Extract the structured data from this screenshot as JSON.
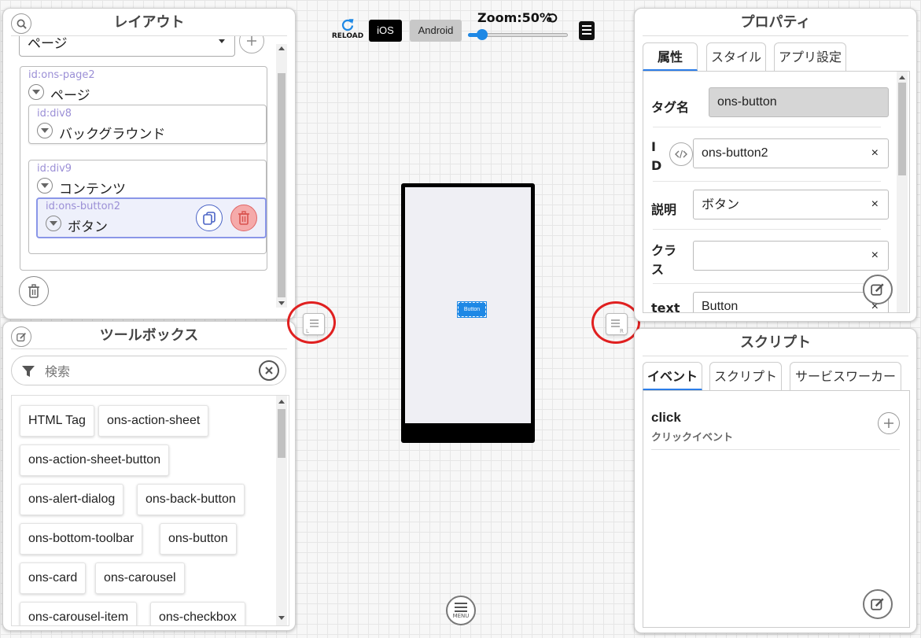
{
  "toolbar": {
    "reload_label": "RELOAD",
    "ios_label": "iOS",
    "android_label": "Android",
    "zoom_label": "Zoom:50%",
    "zoom_value": 0.1
  },
  "layout_panel": {
    "title": "レイアウト",
    "select_value": "ページ",
    "tree": {
      "page": {
        "id": "id:ons-page2",
        "label": "ページ"
      },
      "background": {
        "id": "id:div8",
        "label": "バックグラウンド"
      },
      "content": {
        "id": "id:div9",
        "label": "コンテンツ"
      },
      "button": {
        "id": "id:ons-button2",
        "label": "ボタン"
      }
    }
  },
  "toolbox_panel": {
    "title": "ツールボックス",
    "search_placeholder": "検索",
    "items": [
      "HTML Tag",
      "ons-action-sheet",
      "ons-action-sheet-button",
      "ons-alert-dialog",
      "ons-back-button",
      "ons-bottom-toolbar",
      "ons-button",
      "ons-card",
      "ons-carousel",
      "ons-carousel-item",
      "ons-checkbox"
    ]
  },
  "preview": {
    "button_text": "Button",
    "menu_label": "MENU"
  },
  "properties_panel": {
    "title": "プロパティ",
    "tabs": [
      "属性",
      "スタイル",
      "アプリ設定"
    ],
    "fields": {
      "tag": {
        "label": "タグ名",
        "value": "ons-button"
      },
      "id": {
        "label_1": "I",
        "label_2": "D",
        "value": "ons-button2"
      },
      "description": {
        "label": "説明",
        "value": "ボタン"
      },
      "class": {
        "label_1": "クラ",
        "label_2": "ス",
        "value": ""
      },
      "text": {
        "label": "text",
        "value": "Button"
      }
    },
    "clear_symbol": "×"
  },
  "script_panel": {
    "title": "スクリプト",
    "tabs": [
      "イベント",
      "スクリプト",
      "サービスワーカー"
    ],
    "events": [
      {
        "name": "click",
        "description": "クリックイベント"
      }
    ]
  },
  "colors": {
    "accent": "#2b7de9",
    "delete_red": "#e06666",
    "selected_bg": "#eef0fb",
    "selected_border": "#8a96e8"
  }
}
